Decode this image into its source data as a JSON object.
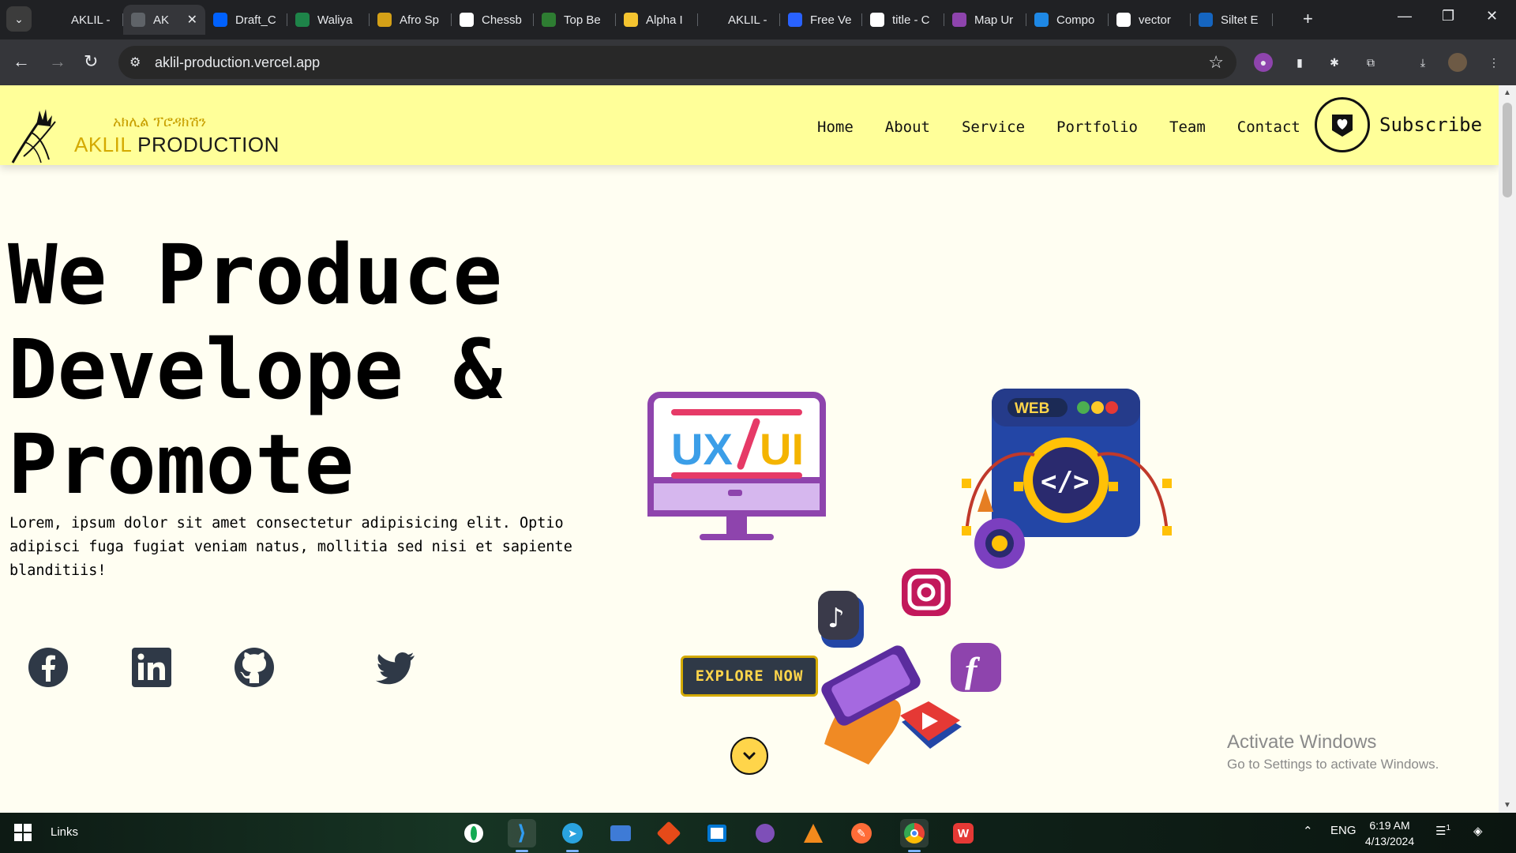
{
  "browser": {
    "tabs": [
      {
        "title": "AKLIL -",
        "favicon_color": "#202124",
        "active": false
      },
      {
        "title": "AK",
        "favicon_color": "#5f6368",
        "active": true
      },
      {
        "title": "Draft_C",
        "favicon_color": "#0061fe",
        "active": false
      },
      {
        "title": "Waliya",
        "favicon_color": "#1e8449",
        "active": false
      },
      {
        "title": "Afro Sp",
        "favicon_color": "#d4a017",
        "active": false
      },
      {
        "title": "Chessb",
        "favicon_color": "#ffffff",
        "active": false
      },
      {
        "title": "Top Be",
        "favicon_color": "#2e7d32",
        "active": false
      },
      {
        "title": "Alpha I",
        "favicon_color": "#f4c430",
        "active": false
      },
      {
        "title": "AKLIL -",
        "favicon_color": "#202124",
        "active": false
      },
      {
        "title": "Free Ve",
        "favicon_color": "#2962ff",
        "active": false
      },
      {
        "title": "title - C",
        "favicon_color": "#ffffff",
        "active": false
      },
      {
        "title": "Map Ur",
        "favicon_color": "#8e44ad",
        "active": false
      },
      {
        "title": "Compo",
        "favicon_color": "#1e88e5",
        "active": false
      },
      {
        "title": "vector",
        "favicon_color": "#ffffff",
        "active": false
      },
      {
        "title": "Siltet E",
        "favicon_color": "#1565c0",
        "active": false
      }
    ],
    "new_tab_icon": "plus-icon",
    "url": "aklil-production.vercel.app"
  },
  "site": {
    "brand_amharic": "አክሊል ፕሮዳክሽን",
    "brand_part1": "AKLIL",
    "brand_part2": "PRODUCTION",
    "nav": [
      "Home",
      "About",
      "Service",
      "Portfolio",
      "Team",
      "Contact"
    ],
    "subscribe_label": "Subscribe",
    "hero_title": "We Produce\nDevelope &\nPromote",
    "hero_subtitle": "Lorem, ipsum dolor sit amet consectetur adipisicing elit. Optio adipisci fuga fugiat veniam natus, mollitia sed nisi et sapiente blanditiis!",
    "socials": [
      "facebook",
      "linkedin",
      "github",
      "twitter"
    ],
    "explore_label": "EXPLORE NOW",
    "illustration": {
      "monitor_text_1": "UX",
      "monitor_text_2": "UI",
      "web_label": "WEB"
    },
    "colors": {
      "header_bg": "#ffff99",
      "page_bg": "#fffef2",
      "accent": "#d4aa00",
      "button_bg": "#2f3947"
    }
  },
  "windows_watermark": {
    "title": "Activate Windows",
    "subtitle": "Go to Settings to activate Windows."
  },
  "taskbar": {
    "links_label": "Links",
    "tray_language": "ENG",
    "time": "6:19 AM",
    "date": "4/13/2024",
    "notification_count": "1"
  }
}
